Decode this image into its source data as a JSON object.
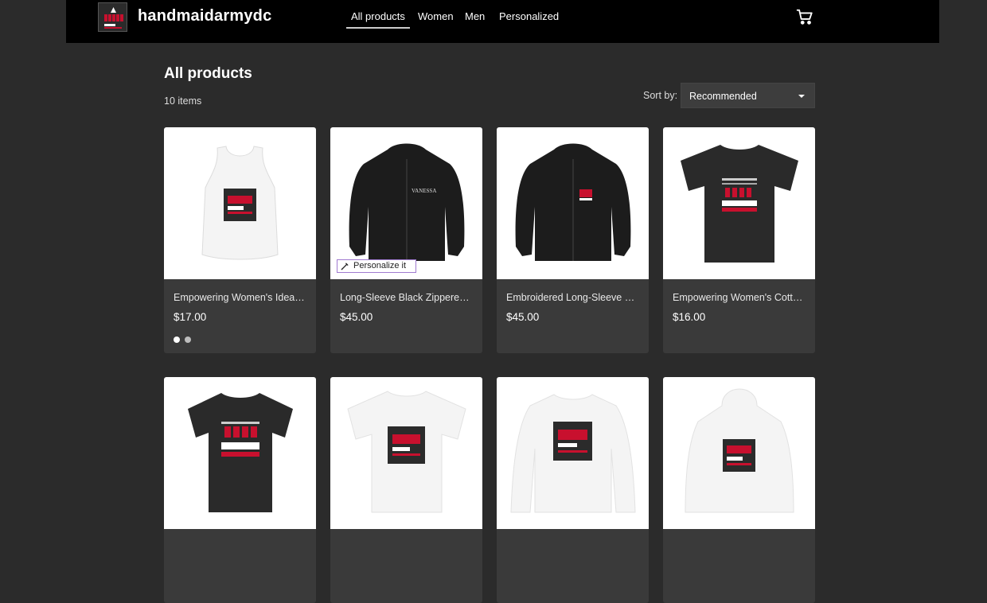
{
  "header": {
    "brand": "handmaidarmydc",
    "nav": [
      "All products",
      "Women",
      "Men",
      "Personalized"
    ],
    "cart_icon": "cart-icon"
  },
  "main": {
    "title": "All products",
    "item_count": "10 items",
    "sort_label": "Sort by:",
    "sort_value": "Recommended"
  },
  "products": [
    {
      "name": "Empowering Women's Ideal Racerback Tank",
      "price": "$17.00",
      "kind": "tank",
      "color": "#f4f4f4",
      "has_dots": true,
      "dots": [
        "#ffffff",
        "#bdbdbd"
      ]
    },
    {
      "name": "Long-Sleeve Black Zippered Hoodie",
      "price": "$45.00",
      "kind": "hoodie",
      "color": "#1c1c1c",
      "personalize_label": "Personalize it",
      "hoodie_text": "VANESSA"
    },
    {
      "name": "Embroidered Long-Sleeve Black Hoodie",
      "price": "$45.00",
      "kind": "hoodie",
      "color": "#1c1c1c"
    },
    {
      "name": "Empowering Women's Cotton Tee",
      "price": "$16.00",
      "kind": "tee",
      "color": "#2a2a2a"
    },
    {
      "kind": "tee",
      "color": "#2a2a2a"
    },
    {
      "kind": "tee",
      "color": "#f4f4f4"
    },
    {
      "kind": "longsleeve",
      "color": "#f4f4f4"
    },
    {
      "kind": "pullover",
      "color": "#f4f4f4"
    }
  ],
  "colors": {
    "header_bg": "#000000",
    "page_bg": "#2b2b2b",
    "card_bg": "#3a3a3a",
    "accent_red": "#c8102e"
  }
}
